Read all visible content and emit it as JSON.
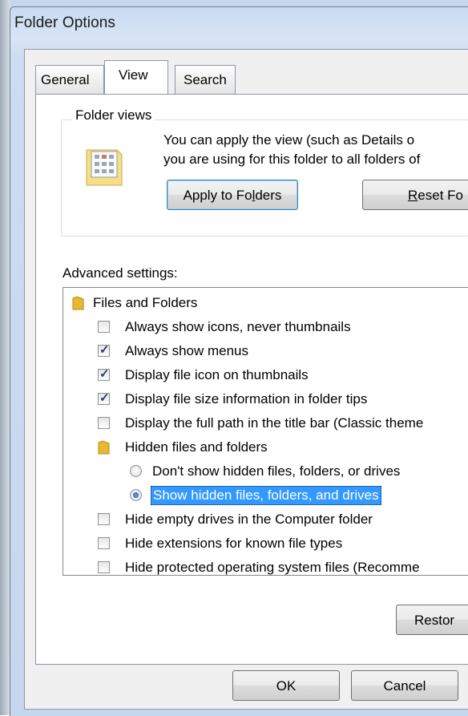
{
  "window": {
    "title": "Folder Options"
  },
  "tabs": [
    {
      "label": "General",
      "active": false
    },
    {
      "label": "View",
      "active": true
    },
    {
      "label": "Search",
      "active": false
    }
  ],
  "folder_views": {
    "group_label": "Folder views",
    "description_line1": "You can apply the view (such as Details o",
    "description_line2": "you are using for this folder to all folders of",
    "apply_button_pre": "Apply to Fo",
    "apply_button_access": "l",
    "apply_button_post": "ders",
    "reset_button_access": "R",
    "reset_button_post": "eset Fo"
  },
  "advanced": {
    "label": "Advanced settings:",
    "items": [
      {
        "type": "folder",
        "label": "Files and Folders"
      },
      {
        "type": "checkbox",
        "checked": false,
        "label": "Always show icons, never thumbnails"
      },
      {
        "type": "checkbox",
        "checked": true,
        "label": "Always show menus"
      },
      {
        "type": "checkbox",
        "checked": true,
        "label": "Display file icon on thumbnails"
      },
      {
        "type": "checkbox",
        "checked": true,
        "label": "Display file size information in folder tips"
      },
      {
        "type": "checkbox",
        "checked": false,
        "label": "Display the full path in the title bar (Classic theme"
      },
      {
        "type": "folder",
        "label": "Hidden files and folders"
      },
      {
        "type": "radio",
        "checked": false,
        "label": "Don't show hidden files, folders, or drives"
      },
      {
        "type": "radio",
        "checked": true,
        "selected": true,
        "label": "Show hidden files, folders, and drives"
      },
      {
        "type": "checkbox",
        "checked": false,
        "label": "Hide empty drives in the Computer folder"
      },
      {
        "type": "checkbox",
        "checked": false,
        "label": "Hide extensions for known file types"
      },
      {
        "type": "checkbox",
        "checked": false,
        "label": "Hide protected operating system files (Recomme"
      }
    ]
  },
  "restore_button": "Restor",
  "dialog_buttons": {
    "ok": "OK",
    "cancel": "Cancel"
  },
  "colors": {
    "selection": "#3399ff",
    "focus_border": "#3c7fb1",
    "title_bar": "#c9daf0"
  }
}
